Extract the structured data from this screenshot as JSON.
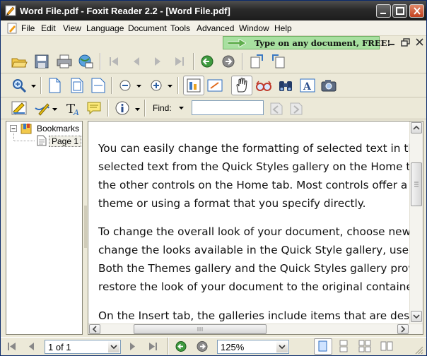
{
  "window": {
    "title": "Word File.pdf - Foxit Reader 2.2 - [Word File.pdf]"
  },
  "menu": [
    "File",
    "Edit",
    "View",
    "Language",
    "Document",
    "Tools",
    "Advanced",
    "Window",
    "Help"
  ],
  "promo": {
    "text": "Type on any document, FREE!"
  },
  "find": {
    "label": "Find:",
    "value": ""
  },
  "bookmarks": {
    "root": "Bookmarks",
    "child": "Page 1"
  },
  "document": {
    "paragraphs": [
      [
        "You can easily change the formatting of selected text in the",
        "selected text from the Quick Styles gallery on the Home tab",
        "the other controls on the Home tab. Most controls offer a c",
        "theme or using a format that you specify directly."
      ],
      [
        "To change the overall look of your document, choose new T",
        "change the looks available in the Quick Style gallery, use the",
        "Both the Themes gallery and the Quick Styles gallery provid",
        "restore the look of your document to the original contained"
      ],
      [
        "On the Insert tab, the galleries include items that are desig"
      ]
    ]
  },
  "status": {
    "page": "1 of 1",
    "zoom": "125%"
  },
  "icons": [
    "open-icon",
    "save-icon",
    "print-icon",
    "email-icon",
    "first-page-icon",
    "previous-page-icon",
    "next-page-icon",
    "last-page-icon",
    "go-back-icon",
    "go-forward-icon",
    "rotate-left-icon",
    "rotate-right-icon",
    "zoom-icon",
    "actual-size-icon",
    "fit-page-icon",
    "fit-width-icon",
    "zoom-out-icon",
    "zoom-in-icon",
    "select-text-icon",
    "snapshot-icon",
    "hand-icon",
    "eyeglasses-icon",
    "binoculars-icon",
    "typewriter-icon",
    "camera-icon",
    "highlight-icon",
    "pen-icon",
    "text-icon",
    "note-icon",
    "info-icon"
  ]
}
